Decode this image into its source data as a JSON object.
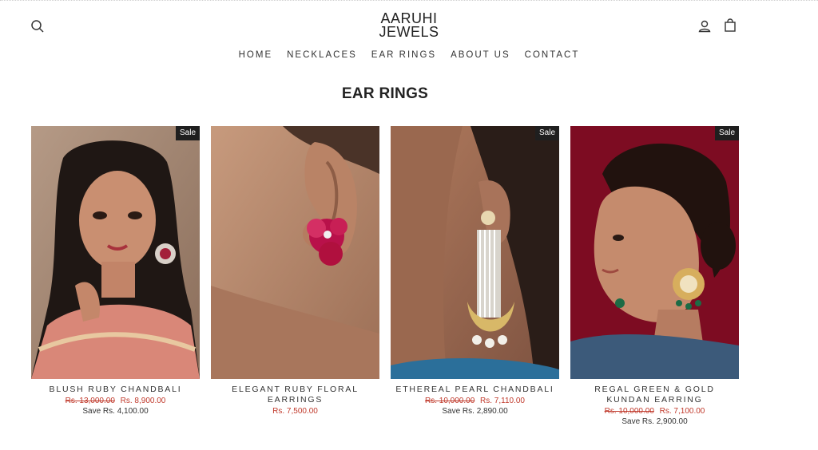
{
  "header": {
    "logo_line1": "AARUHI",
    "logo_line2": "JEWELS"
  },
  "nav": {
    "items": [
      {
        "label": "HOME"
      },
      {
        "label": "NECKLACES"
      },
      {
        "label": "EAR RINGS"
      },
      {
        "label": "ABOUT US"
      },
      {
        "label": "CONTACT"
      }
    ]
  },
  "page": {
    "title": "EAR RINGS"
  },
  "products": [
    {
      "name": "BLUSH RUBY CHANDBALI",
      "badge": "Sale",
      "compare_price": "Rs. 13,000.00",
      "price": "Rs. 8,900.00",
      "savings": "Save Rs. 4,100.00"
    },
    {
      "name": "ELEGANT RUBY FLORAL EARRINGS",
      "price": "Rs. 7,500.00"
    },
    {
      "name": "ETHEREAL PEARL CHANDBALI",
      "badge": "Sale",
      "compare_price": "Rs. 10,000.00",
      "price": "Rs. 7,110.00",
      "savings": "Save Rs. 2,890.00"
    },
    {
      "name": "REGAL GREEN & GOLD KUNDAN EARRING",
      "badge": "Sale",
      "compare_price": "Rs. 10,000.00",
      "price": "Rs. 7,100.00",
      "savings": "Save Rs. 2,900.00"
    }
  ],
  "colors": {
    "sale_price": "#c0392b",
    "badge_bg": "#1f1f1f",
    "text": "#222222"
  }
}
